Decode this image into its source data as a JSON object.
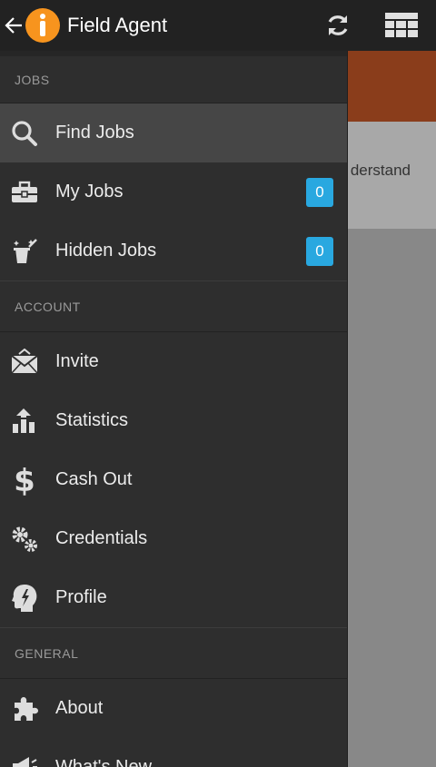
{
  "appbar": {
    "title": "Field Agent",
    "icons": [
      "back-arrow-icon",
      "app-logo",
      "refresh-icon",
      "grid-menu-icon"
    ]
  },
  "background": {
    "card_text": "derstand",
    "banner_color": "#8a3d1b"
  },
  "drawer": {
    "sections": {
      "jobs": "JOBS",
      "account": "ACCOUNT",
      "general": "GENERAL"
    },
    "items": {
      "find_jobs": {
        "label": "Find Jobs",
        "icon": "search-icon"
      },
      "my_jobs": {
        "label": "My Jobs",
        "icon": "briefcase-icon",
        "badge": "0"
      },
      "hidden_jobs": {
        "label": "Hidden Jobs",
        "icon": "magic-hat-icon",
        "badge": "0"
      },
      "invite": {
        "label": "Invite",
        "icon": "envelope-icon"
      },
      "statistics": {
        "label": "Statistics",
        "icon": "chart-icon"
      },
      "cash_out": {
        "label": "Cash Out",
        "icon": "dollar-icon"
      },
      "credentials": {
        "label": "Credentials",
        "icon": "gears-icon"
      },
      "profile": {
        "label": "Profile",
        "icon": "head-icon"
      },
      "about": {
        "label": "About",
        "icon": "puzzle-icon"
      },
      "whats_new": {
        "label": "What's New",
        "icon": "megaphone-icon"
      }
    }
  },
  "colors": {
    "badge": "#29a8e0",
    "logo": "#f7941e",
    "drawer_bg": "#2e2e2e",
    "active_item": "#464646"
  }
}
